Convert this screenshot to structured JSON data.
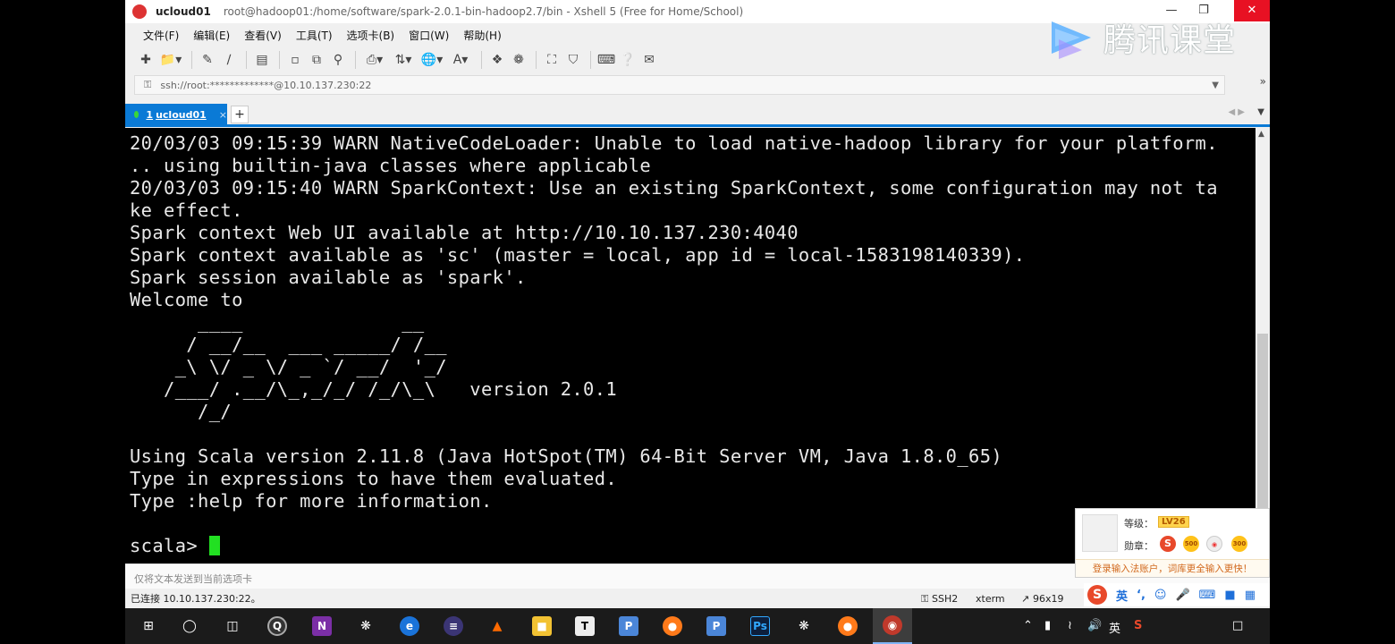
{
  "window": {
    "name": "ucloud01",
    "path": "root@hadoop01:/home/software/spark-2.0.1-bin-hadoop2.7/bin - Xshell 5 (Free for Home/School)",
    "min_icon": "minimize-icon",
    "max_icon": "maximize-icon",
    "close_icon": "close-icon"
  },
  "watermark": {
    "text": "腾讯课堂"
  },
  "menu": [
    "文件(F)",
    "编辑(E)",
    "查看(V)",
    "工具(T)",
    "选项卡(B)",
    "窗口(W)",
    "帮助(H)"
  ],
  "toolbar": {
    "icons": [
      "new-session-icon",
      "open-folder-icon",
      "pencil-icon",
      "eraser-icon",
      "properties-icon",
      "paste-icon",
      "copy-icon",
      "find-icon",
      "print-icon",
      "transfer-icon",
      "globe-icon",
      "font-icon",
      "xftp-icon",
      "script-icon",
      "fullscreen-icon",
      "lock-icon",
      "keyboard-icon",
      "help-icon",
      "chat-icon"
    ]
  },
  "address": {
    "value": "ssh://root:*************@10.10.137.230:22"
  },
  "tabs": [
    {
      "number": "1",
      "label": "ucloud01"
    }
  ],
  "terminal": {
    "lines": [
      "20/03/03 09:15:39 WARN NativeCodeLoader: Unable to load native-hadoop library for your platform.",
      ".. using builtin-java classes where applicable",
      "20/03/03 09:15:40 WARN SparkContext: Use an existing SparkContext, some configuration may not ta",
      "ke effect.",
      "Spark context Web UI available at http://10.10.137.230:4040",
      "Spark context available as 'sc' (master = local, app id = local-1583198140339).",
      "Spark session available as 'spark'.",
      "Welcome to",
      "      ____              __",
      "     / __/__  ___ _____/ /__",
      "    _\\ \\/ _ \\/ _ `/ __/  '_/",
      "   /___/ .__/\\_,_/_/ /_/\\_\\   version 2.0.1",
      "      /_/",
      "",
      "Using Scala version 2.11.8 (Java HotSpot(TM) 64-Bit Server VM, Java 1.8.0_65)",
      "Type in expressions to have them evaluated.",
      "Type :help for more information.",
      ""
    ],
    "prompt": "scala> "
  },
  "sendbar": {
    "placeholder": "仅将文本发送到当前选项卡"
  },
  "status": {
    "connection": "已连接 10.10.137.230:22。",
    "protocol": "SSH2",
    "term": "xterm",
    "size": "96x19"
  },
  "ime_popup": {
    "level_label": "等级：",
    "level": "LV26",
    "medal_label": "勋章：",
    "badges": [
      "S",
      "500",
      "300"
    ],
    "tip": "登录输入法账户，词库更全输入更快！"
  },
  "ime_bar": {
    "lang": "英"
  },
  "tray": {
    "lang": "英"
  },
  "colors": {
    "accent": "#0a7ad6",
    "cursor": "#22e022",
    "close": "#e81123"
  }
}
